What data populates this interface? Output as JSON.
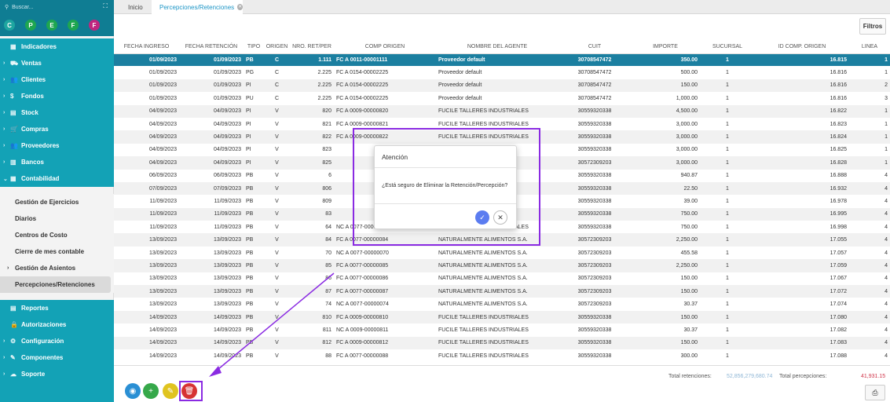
{
  "sidebar": {
    "search_placeholder": "Buscar...",
    "circles": [
      {
        "label": "C",
        "color": "#1ea6a0"
      },
      {
        "label": "P",
        "color": "#1ea650"
      },
      {
        "label": "E",
        "color": "#1ea650"
      },
      {
        "label": "F",
        "color": "#1ea650"
      },
      {
        "label": "F",
        "color": "#c0267f"
      }
    ],
    "menu": [
      {
        "label": "Indicadores",
        "chev": "",
        "icon": "▦"
      },
      {
        "label": "Ventas",
        "chev": "›",
        "icon": "⛟"
      },
      {
        "label": "Clientes",
        "chev": "›",
        "icon": "👥"
      },
      {
        "label": "Fondos",
        "chev": "›",
        "icon": "$"
      },
      {
        "label": "Stock",
        "chev": "›",
        "icon": "▤"
      },
      {
        "label": "Compras",
        "chev": "›",
        "icon": "🛒"
      },
      {
        "label": "Proveedores",
        "chev": "›",
        "icon": "👥"
      },
      {
        "label": "Bancos",
        "chev": "›",
        "icon": "▥"
      },
      {
        "label": "Contabilidad",
        "chev": "⌄",
        "icon": "▦"
      }
    ],
    "submenu": [
      {
        "label": "Gestión de Ejercicios",
        "chev": false
      },
      {
        "label": "Diarios",
        "chev": false
      },
      {
        "label": "Centros de Costo",
        "chev": false
      },
      {
        "label": "Cierre de mes contable",
        "chev": false
      },
      {
        "label": "Gestión de Asientos",
        "chev": true
      },
      {
        "label": "Percepciones/Retenciones",
        "chev": false,
        "active": true
      }
    ],
    "menu2": [
      {
        "label": "Reportes",
        "chev": "",
        "icon": "▤"
      },
      {
        "label": "Autorizaciones",
        "chev": "",
        "icon": "🔒"
      },
      {
        "label": "Configuración",
        "chev": "›",
        "icon": "⚙"
      },
      {
        "label": "Componentes",
        "chev": "›",
        "icon": "✎"
      },
      {
        "label": "Soporte",
        "chev": "›",
        "icon": "☁"
      }
    ]
  },
  "tabs": {
    "home": "Inicio",
    "current": "Percepciones/Retenciones"
  },
  "filters_label": "Filtros",
  "table": {
    "columns": [
      "FECHA INGRESO",
      "FECHA RETENCIÓN",
      "TIPO",
      "ORIGEN",
      "NRO. RET/PER",
      "COMP ORIGEN",
      "NOMBRE DEL AGENTE",
      "CUIT",
      "IMPORTE",
      "SUCURSAL",
      "ID COMP. ORIGEN",
      "LINEA"
    ],
    "rows": [
      [
        "01/09/2023",
        "01/09/2023",
        "PB",
        "C",
        "1.111",
        "FC A 0011-00001111",
        "Proveedor default",
        "30708547472",
        "350.00",
        "1",
        "16.815",
        "1"
      ],
      [
        "01/09/2023",
        "01/09/2023",
        "PG",
        "C",
        "2.225",
        "FC A 0154-00002225",
        "Proveedor default",
        "30708547472",
        "500.00",
        "1",
        "16.816",
        "1"
      ],
      [
        "01/09/2023",
        "01/09/2023",
        "PI",
        "C",
        "2.225",
        "FC A 0154-00002225",
        "Proveedor default",
        "30708547472",
        "150.00",
        "1",
        "16.816",
        "2"
      ],
      [
        "01/09/2023",
        "01/09/2023",
        "PU",
        "C",
        "2.225",
        "FC A 0154-00002225",
        "Proveedor default",
        "30708547472",
        "1,000.00",
        "1",
        "16.816",
        "3"
      ],
      [
        "04/09/2023",
        "04/09/2023",
        "PI",
        "V",
        "820",
        "FC A 0009-00000820",
        "FUCILE TALLERES INDUSTRIALES",
        "30559320338",
        "4,500.00",
        "1",
        "16.822",
        "1"
      ],
      [
        "04/09/2023",
        "04/09/2023",
        "PI",
        "V",
        "821",
        "FC A 0009-00000821",
        "FUCILE TALLERES INDUSTRIALES",
        "30559320338",
        "3,000.00",
        "1",
        "16.823",
        "1"
      ],
      [
        "04/09/2023",
        "04/09/2023",
        "PI",
        "V",
        "822",
        "FC A 0009-00000822",
        "FUCILE TALLERES INDUSTRIALES",
        "30559320338",
        "3,000.00",
        "1",
        "16.824",
        "1"
      ],
      [
        "04/09/2023",
        "04/09/2023",
        "PI",
        "V",
        "823",
        "",
        "INDUSTRIALES",
        "30559320338",
        "3,000.00",
        "1",
        "16.825",
        "1"
      ],
      [
        "04/09/2023",
        "04/09/2023",
        "PI",
        "V",
        "825",
        "",
        "ALIMENTOS S.A.",
        "30572309203",
        "3,000.00",
        "1",
        "16.828",
        "1"
      ],
      [
        "06/09/2023",
        "06/09/2023",
        "PB",
        "V",
        "6",
        "",
        "INDUSTRIALES",
        "30559320338",
        "940.87",
        "1",
        "16.888",
        "4"
      ],
      [
        "07/09/2023",
        "07/09/2023",
        "PB",
        "V",
        "806",
        "",
        "INDUSTRIALES",
        "30559320338",
        "22.50",
        "1",
        "16.932",
        "4"
      ],
      [
        "11/09/2023",
        "11/09/2023",
        "PB",
        "V",
        "809",
        "",
        "INDUSTRIALES",
        "30559320338",
        "39.00",
        "1",
        "16.978",
        "4"
      ],
      [
        "11/09/2023",
        "11/09/2023",
        "PB",
        "V",
        "83",
        "",
        "INDUSTRIALES",
        "30559320338",
        "750.00",
        "1",
        "16.995",
        "4"
      ],
      [
        "11/09/2023",
        "11/09/2023",
        "PB",
        "V",
        "64",
        "NC A 0077-00000064",
        "FUCILE TALLERES INDUSTRIALES",
        "30559320338",
        "750.00",
        "1",
        "16.998",
        "4"
      ],
      [
        "13/09/2023",
        "13/09/2023",
        "PB",
        "V",
        "84",
        "FC A 0077-00000084",
        "NATURALMENTE ALIMENTOS S.A.",
        "30572309203",
        "2,250.00",
        "1",
        "17.055",
        "4"
      ],
      [
        "13/09/2023",
        "13/09/2023",
        "PB",
        "V",
        "70",
        "NC A 0077-00000070",
        "NATURALMENTE ALIMENTOS S.A.",
        "30572309203",
        "455.58",
        "1",
        "17.057",
        "4"
      ],
      [
        "13/09/2023",
        "13/09/2023",
        "PB",
        "V",
        "85",
        "FC A 0077-00000085",
        "NATURALMENTE ALIMENTOS S.A.",
        "30572309203",
        "2,250.00",
        "1",
        "17.059",
        "4"
      ],
      [
        "13/09/2023",
        "13/09/2023",
        "PB",
        "V",
        "86",
        "FC A 0077-00000086",
        "NATURALMENTE ALIMENTOS S.A.",
        "30572309203",
        "150.00",
        "1",
        "17.067",
        "4"
      ],
      [
        "13/09/2023",
        "13/09/2023",
        "PB",
        "V",
        "87",
        "FC A 0077-00000087",
        "NATURALMENTE ALIMENTOS S.A.",
        "30572309203",
        "150.00",
        "1",
        "17.072",
        "4"
      ],
      [
        "13/09/2023",
        "13/09/2023",
        "PB",
        "V",
        "74",
        "NC A 0077-00000074",
        "NATURALMENTE ALIMENTOS S.A.",
        "30572309203",
        "30.37",
        "1",
        "17.074",
        "4"
      ],
      [
        "14/09/2023",
        "14/09/2023",
        "PB",
        "V",
        "810",
        "FC A 0009-00000810",
        "FUCILE TALLERES INDUSTRIALES",
        "30559320338",
        "150.00",
        "1",
        "17.080",
        "4"
      ],
      [
        "14/09/2023",
        "14/09/2023",
        "PB",
        "V",
        "811",
        "NC A 0009-00000811",
        "FUCILE TALLERES INDUSTRIALES",
        "30559320338",
        "30.37",
        "1",
        "17.082",
        "4"
      ],
      [
        "14/09/2023",
        "14/09/2023",
        "PB",
        "V",
        "812",
        "FC A 0009-00000812",
        "FUCILE TALLERES INDUSTRIALES",
        "30559320338",
        "150.00",
        "1",
        "17.083",
        "4"
      ],
      [
        "14/09/2023",
        "14/09/2023",
        "PB",
        "V",
        "88",
        "FC A 0077-00000088",
        "FUCILE TALLERES INDUSTRIALES",
        "30559320338",
        "300.00",
        "1",
        "17.088",
        "4"
      ]
    ]
  },
  "footer": {
    "total_ret_label": "Total retenciones:",
    "total_ret_value": "52,856,279,680.74",
    "total_per_label": "Total percepciones:",
    "total_per_value": "41,931.15"
  },
  "dialog": {
    "title": "Atención",
    "message": "¿Está seguro de Eliminar la Retención/Percepción?"
  },
  "colors": {
    "accent": "#13a2b6",
    "selected_row": "#1b7fa0",
    "annotation": "#8a2be2"
  }
}
